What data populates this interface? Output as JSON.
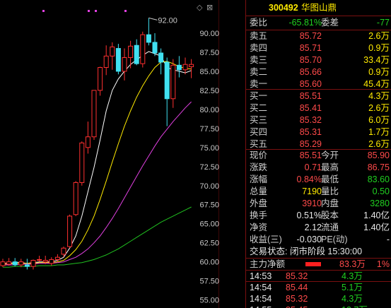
{
  "stock": {
    "code": "300492",
    "name": "华图山鼎"
  },
  "chart_data": {
    "type": "candlestick",
    "y_ticks": [
      "90.00",
      "87.50",
      "85.00",
      "82.50",
      "80.00",
      "77.50",
      "75.00",
      "72.50",
      "70.00",
      "67.50",
      "65.00",
      "62.50",
      "60.00",
      "57.50",
      "55.00"
    ],
    "ylim": [
      54.5,
      92.5
    ],
    "high_label": "92.00",
    "candles": [
      {
        "o": 59.5,
        "h": 60.4,
        "l": 59.3,
        "c": 60.0
      },
      {
        "o": 59.7,
        "h": 60.5,
        "l": 59.5,
        "c": 60.0
      },
      {
        "o": 60.0,
        "h": 60.5,
        "l": 59.4,
        "c": 59.6
      },
      {
        "o": 59.6,
        "h": 60.4,
        "l": 59.3,
        "c": 60.0
      },
      {
        "o": 59.6,
        "h": 60.4,
        "l": 59.0,
        "c": 59.4
      },
      {
        "o": 59.4,
        "h": 60.3,
        "l": 59.0,
        "c": 60.2
      },
      {
        "o": 60.3,
        "h": 60.8,
        "l": 60.0,
        "c": 60.3
      },
      {
        "o": 60.0,
        "h": 60.8,
        "l": 59.7,
        "c": 60.2
      },
      {
        "o": 59.8,
        "h": 60.6,
        "l": 59.5,
        "c": 60.3
      },
      {
        "o": 60.3,
        "h": 61.0,
        "l": 60.0,
        "c": 60.6
      },
      {
        "o": 61.0,
        "h": 62.0,
        "l": 60.6,
        "c": 61.8
      },
      {
        "o": 62.0,
        "h": 66.2,
        "l": 61.8,
        "c": 66.0
      },
      {
        "o": 66.2,
        "h": 70.6,
        "l": 66.0,
        "c": 70.4
      },
      {
        "o": 70.4,
        "h": 75.8,
        "l": 70.0,
        "c": 75.6
      },
      {
        "o": 75.0,
        "h": 78.4,
        "l": 74.2,
        "c": 76.4
      },
      {
        "o": 76.4,
        "h": 82.5,
        "l": 76.0,
        "c": 82.5
      },
      {
        "o": 82.5,
        "h": 85.6,
        "l": 81.8,
        "c": 85.5
      },
      {
        "o": 85.5,
        "h": 88.4,
        "l": 84.5,
        "c": 87.0
      },
      {
        "o": 87.0,
        "h": 88.8,
        "l": 85.2,
        "c": 88.2
      },
      {
        "o": 88.0,
        "h": 88.6,
        "l": 84.6,
        "c": 85.0
      },
      {
        "o": 85.0,
        "h": 88.0,
        "l": 83.8,
        "c": 86.8
      },
      {
        "o": 86.8,
        "h": 89.0,
        "l": 85.4,
        "c": 88.3
      },
      {
        "o": 88.4,
        "h": 89.2,
        "l": 85.8,
        "c": 86.0
      },
      {
        "o": 86.0,
        "h": 90.2,
        "l": 85.5,
        "c": 89.8
      },
      {
        "o": 89.8,
        "h": 92.0,
        "l": 88.4,
        "c": 88.8
      },
      {
        "o": 88.8,
        "h": 90.0,
        "l": 87.0,
        "c": 87.4
      },
      {
        "o": 87.4,
        "h": 88.0,
        "l": 84.6,
        "c": 86.2
      },
      {
        "o": 86.2,
        "h": 86.8,
        "l": 77.8,
        "c": 81.4
      },
      {
        "o": 81.4,
        "h": 86.6,
        "l": 80.2,
        "c": 85.8
      },
      {
        "o": 85.8,
        "h": 87.0,
        "l": 84.2,
        "c": 85.2
      },
      {
        "o": 85.2,
        "h": 86.8,
        "l": 84.6,
        "c": 85.9
      },
      {
        "o": 85.6,
        "h": 86.6,
        "l": 84.1,
        "c": 85.9
      }
    ],
    "ma_lines": [
      {
        "color": "#ffffff",
        "values": [
          59.8,
          59.8,
          59.9,
          59.9,
          59.8,
          59.9,
          60.0,
          60.0,
          60.0,
          60.2,
          60.6,
          61.8,
          63.4,
          66.0,
          69.2,
          72.4,
          76.0,
          79.8,
          82.5,
          84.0,
          85.0,
          85.9,
          86.5,
          87.1,
          87.6,
          87.3,
          87.0,
          85.5,
          85.2,
          85.0,
          84.8,
          85.1
        ]
      },
      {
        "color": "#ffea00",
        "values": [
          59.7,
          59.7,
          59.8,
          59.8,
          59.8,
          59.8,
          59.9,
          59.9,
          59.9,
          60.0,
          60.2,
          60.8,
          61.6,
          62.7,
          64.2,
          66.0,
          68.2,
          70.6,
          73.1,
          75.5,
          77.8,
          79.8,
          81.6,
          83.1,
          84.4,
          85.5,
          86.2,
          86.3,
          86.0,
          85.6,
          85.4,
          85.3
        ]
      },
      {
        "color": "#e040e0",
        "values": [
          59.6,
          59.6,
          59.6,
          59.7,
          59.7,
          59.7,
          59.8,
          59.8,
          59.8,
          59.9,
          60.0,
          60.3,
          60.6,
          61.1,
          61.7,
          62.5,
          63.4,
          64.5,
          65.7,
          67.0,
          68.4,
          69.8,
          71.2,
          72.6,
          73.9,
          75.2,
          76.4,
          77.4,
          78.4,
          79.3,
          80.2,
          81.0
        ]
      },
      {
        "color": "#20c020",
        "values": [
          59.3,
          59.3,
          59.4,
          59.4,
          59.4,
          59.4,
          59.5,
          59.5,
          59.5,
          59.6,
          59.6,
          59.7,
          59.8,
          59.9,
          60.1,
          60.3,
          60.6,
          60.9,
          61.3,
          61.7,
          62.2,
          62.7,
          63.2,
          63.7,
          64.2,
          64.7,
          65.2,
          65.6,
          66.0,
          66.4,
          66.8,
          67.2
        ]
      }
    ]
  },
  "chart_controls": {
    "diamond": "◇",
    "close": "⊠"
  },
  "quote": {
    "weibi_label": "委比",
    "weibi_value": "-65.81%",
    "weicha_label": "委差",
    "weicha_value": "-77",
    "asks": [
      {
        "label": "卖五",
        "price": "85.72",
        "vol": "2.6万"
      },
      {
        "label": "卖四",
        "price": "85.71",
        "vol": "0.9万"
      },
      {
        "label": "卖三",
        "price": "85.70",
        "vol": "33.4万"
      },
      {
        "label": "卖二",
        "price": "85.66",
        "vol": "0.9万"
      },
      {
        "label": "卖一",
        "price": "85.60",
        "vol": "45.4万"
      }
    ],
    "bids": [
      {
        "label": "买一",
        "price": "85.51",
        "vol": "4.3万"
      },
      {
        "label": "买二",
        "price": "85.41",
        "vol": "2.6万"
      },
      {
        "label": "买三",
        "price": "85.32",
        "vol": "6.0万"
      },
      {
        "label": "买四",
        "price": "85.31",
        "vol": "1.7万"
      },
      {
        "label": "买五",
        "price": "85.29",
        "vol": "2.6万"
      }
    ],
    "stats": [
      {
        "l1": "现价",
        "v1": "85.51",
        "l2": "今开",
        "v2": "85.90"
      },
      {
        "l1": "涨跌",
        "v1": "0.71",
        "l2": "最高",
        "v2": "86.75"
      },
      {
        "l1": "涨幅",
        "v1": "0.84%",
        "l2": "最低",
        "v2": "83.60"
      },
      {
        "l1": "总量",
        "v1": "7190",
        "l2": "量比",
        "v2": "0.50"
      },
      {
        "l1": "外盘",
        "v1": "3910",
        "l2": "内盘",
        "v2": "3280"
      },
      {
        "l1": "换手",
        "v1": "0.51%",
        "l2": "股本",
        "v2": "1.40亿"
      },
      {
        "l1": "净资",
        "v1": "2.12",
        "l2": "流通",
        "v2": "1.40亿"
      },
      {
        "l1": "收益(三)",
        "v1": "-0.030",
        "l2": "PE(动)",
        "v2": "-"
      }
    ],
    "status": "交易状态: 闭市阶段 15:30:00",
    "main_flow": {
      "label": "主力净额",
      "value": "83.3万",
      "pct": "1%"
    },
    "ticks": [
      {
        "time": "14:53",
        "price": "85.32",
        "vol": "4.3万"
      },
      {
        "time": "14:54",
        "price": "85.44",
        "vol": "5.1万"
      },
      {
        "time": "14:54",
        "price": "85.32",
        "vol": "4.3万"
      },
      {
        "time": "14:55",
        "price": "85.45",
        "vol": "12.7万"
      }
    ]
  }
}
